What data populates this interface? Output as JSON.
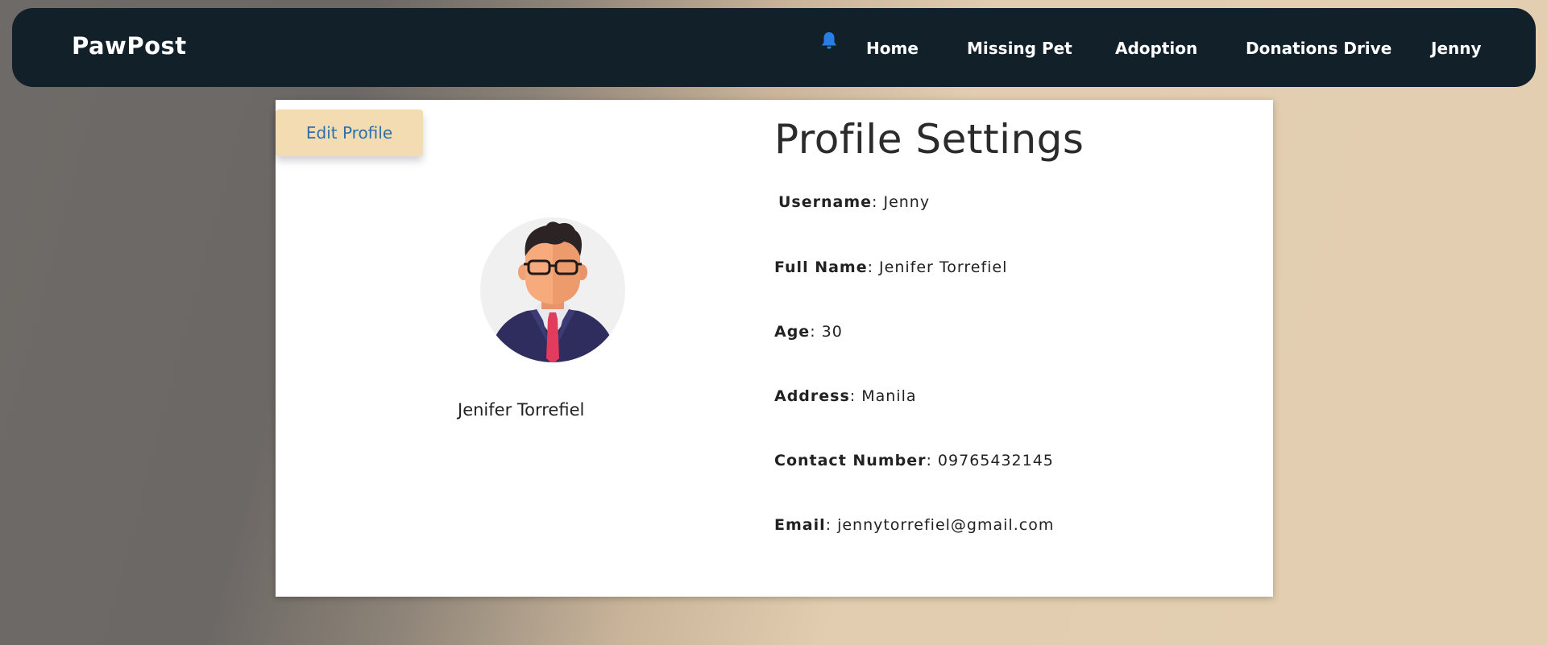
{
  "navbar": {
    "brand": "PawPost",
    "links": [
      "Home",
      "Missing Pet",
      "Adoption",
      "Donations Drive",
      "Jenny"
    ],
    "bell_icon": "bell-icon",
    "bell_color": "#2a7de1"
  },
  "profile": {
    "edit_button": "Edit Profile",
    "display_name": "Jenifer Torrefiel",
    "avatar_icon": "user-avatar-icon",
    "title": "Profile Settings",
    "fields": [
      {
        "label": "Username",
        "value": ": Jenny"
      },
      {
        "label": "Full Name",
        "value": ": Jenifer Torrefiel"
      },
      {
        "label": "Age",
        "value": ": 30"
      },
      {
        "label": "Address",
        "value": ": Manila"
      },
      {
        "label": "Contact Number",
        "value": ": 09765432145"
      },
      {
        "label": "Email",
        "value": ": jennytorrefiel@gmail.com"
      }
    ]
  },
  "colors": {
    "navbar_bg": "#12202a",
    "edit_button_bg": "#f3dcb2",
    "edit_button_text": "#2d6fa8"
  }
}
